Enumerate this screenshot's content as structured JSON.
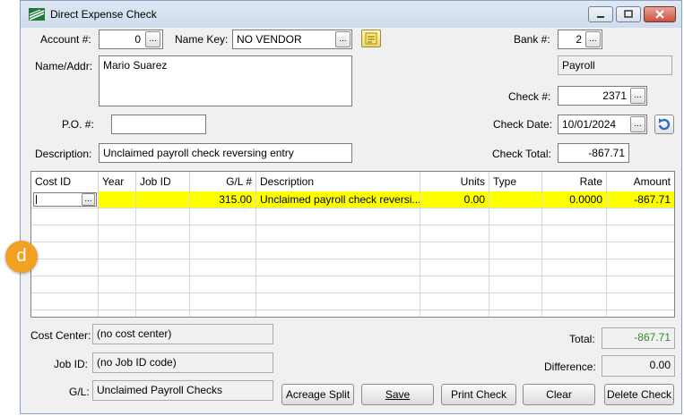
{
  "window": {
    "title": "Direct Expense Check",
    "icon": "green-stripes-app-icon",
    "controls": [
      "minimize-icon",
      "restore-icon",
      "close-icon"
    ]
  },
  "header": {
    "account_label": "Account #:",
    "account_value": "0",
    "name_key_label": "Name Key:",
    "name_key_value": "NO VENDOR",
    "bank_label": "Bank #:",
    "bank_value": "2",
    "bank_name": "Payroll",
    "name_addr_label": "Name/Addr:",
    "name_addr_value": "Mario Suarez",
    "check_label": "Check #:",
    "check_value": "2371",
    "po_label": "P.O. #:",
    "po_value": "",
    "check_date_label": "Check Date:",
    "check_date_value": "10/01/2024",
    "description_label": "Description:",
    "description_value": "Unclaimed payroll check reversing entry",
    "check_total_label": "Check Total:",
    "check_total_value": "-867.71",
    "dots": "..."
  },
  "grid": {
    "columns": [
      "Cost ID",
      "Year",
      "Job ID",
      "G/L #",
      "Description",
      "Units",
      "Type",
      "Rate",
      "Amount"
    ],
    "rows": [
      {
        "cost_id": "",
        "year": "",
        "job_id": "",
        "gl": "315.00",
        "description": "Unclaimed payroll check reversi...",
        "units": "0.00",
        "type": "",
        "rate": "0.0000",
        "amount": "-867.71"
      }
    ]
  },
  "footer": {
    "cost_center_label": "Cost Center:",
    "cost_center_value": "(no cost center)",
    "job_id_label": "Job ID:",
    "job_id_value": "(no Job ID code)",
    "gl_label": "G/L:",
    "gl_value": "Unclaimed Payroll Checks",
    "total_label": "Total:",
    "total_value": "-867.71",
    "difference_label": "Difference:",
    "difference_value": "0.00"
  },
  "buttons": {
    "acreage_split": "Acreage Split",
    "save": "Save",
    "print_check": "Print Check",
    "clear": "Clear",
    "delete_check": "Delete Check"
  },
  "badge": "d",
  "colors": {
    "row_highlight": "#ffff00",
    "total_green": "#2e8b2e",
    "badge_orange": "#f0a122"
  }
}
